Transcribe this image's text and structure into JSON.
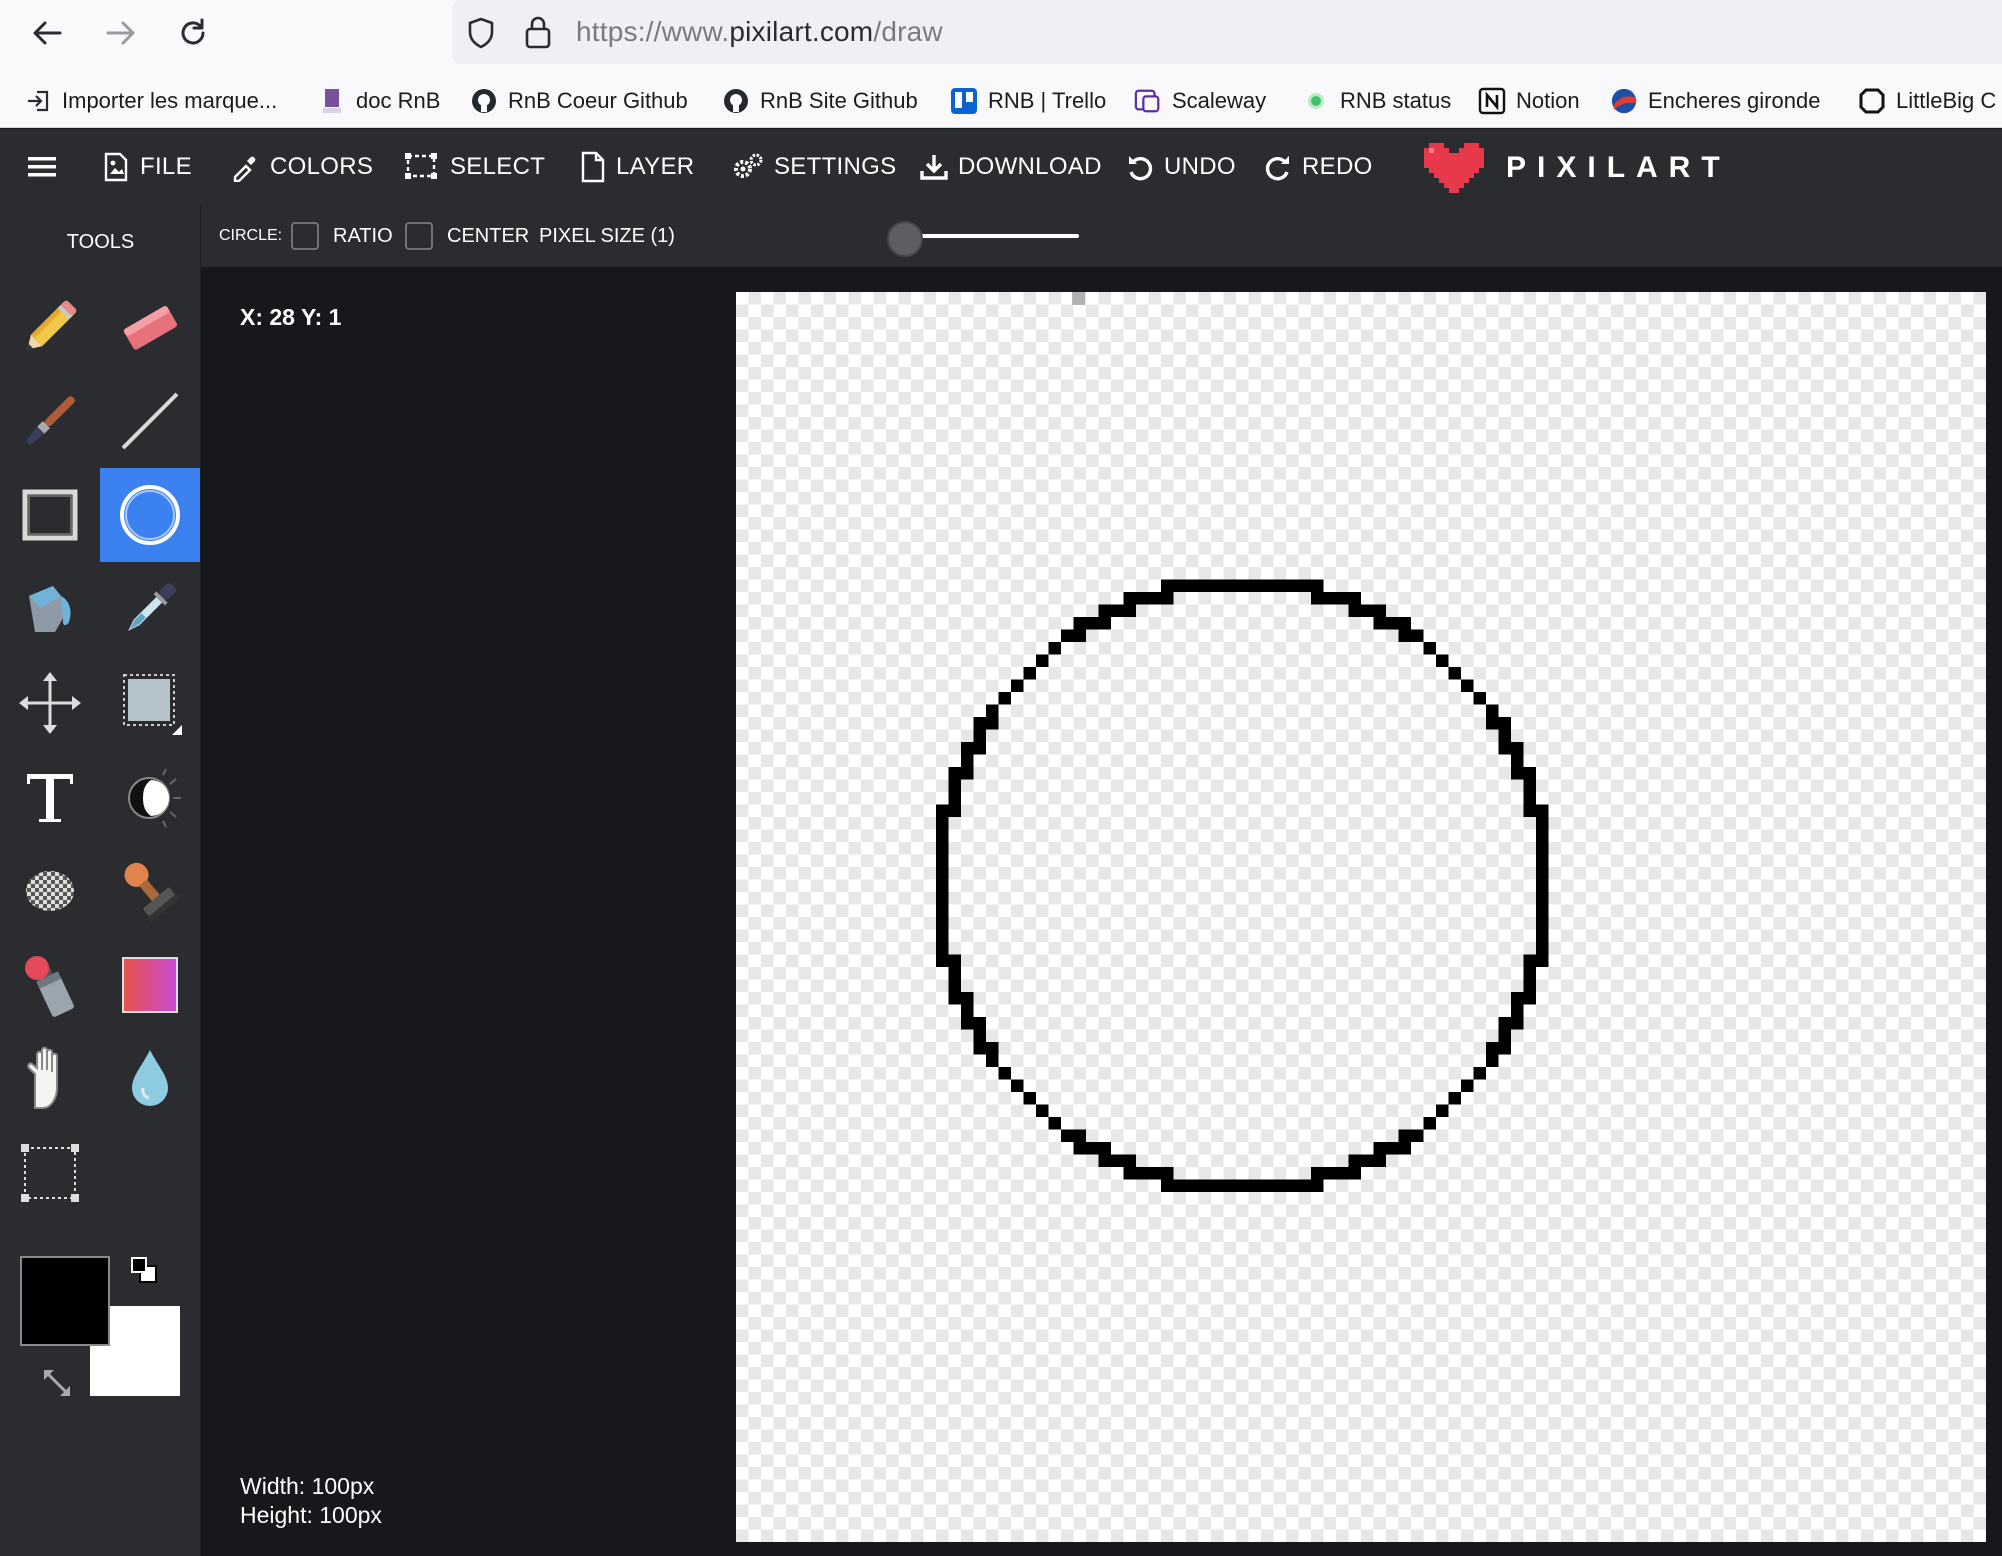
{
  "browser": {
    "url_prefix": "https://www.",
    "url_domain": "pixilart.com",
    "url_path": "/draw",
    "bookmarks": [
      {
        "label": "Importer les marque...",
        "icon": "import-icon"
      },
      {
        "label": "doc RnB",
        "icon": "doc-icon"
      },
      {
        "label": "RnB Coeur Github",
        "icon": "github-icon"
      },
      {
        "label": "RnB Site Github",
        "icon": "github-icon"
      },
      {
        "label": "RNB | Trello",
        "icon": "trello-icon"
      },
      {
        "label": "Scaleway",
        "icon": "scaleway-icon"
      },
      {
        "label": "RNB status",
        "icon": "status-dot-icon"
      },
      {
        "label": "Notion",
        "icon": "notion-icon"
      },
      {
        "label": "Encheres gironde",
        "icon": "encheres-icon"
      },
      {
        "label": "LittleBig C",
        "icon": "littlebig-icon"
      }
    ]
  },
  "app": {
    "menu": {
      "file": "FILE",
      "colors": "COLORS",
      "select": "SELECT",
      "layer": "LAYER",
      "settings": "SETTINGS",
      "download": "DOWNLOAD",
      "undo": "UNDO",
      "redo": "REDO"
    },
    "logo": "PIXILART",
    "accent_color": "#3b82f0",
    "logo_color": "#e8394a"
  },
  "options": {
    "tool_label": "CIRCLE:",
    "ratio_label": "RATIO",
    "ratio_checked": false,
    "center_label": "CENTER",
    "center_checked": false,
    "pixel_size_label": "PIXEL SIZE (1)"
  },
  "tools": {
    "title": "TOOLS",
    "active": "circle-tool",
    "items": [
      "pencil",
      "eraser",
      "brush",
      "line",
      "rectangle",
      "circle",
      "fill-bucket",
      "eyedropper",
      "move",
      "selection",
      "text",
      "lighten-darken",
      "dither",
      "stamp",
      "spray",
      "gradient",
      "hand",
      "blur",
      "crop"
    ]
  },
  "colors": {
    "primary": "#000000",
    "secondary": "#ffffff"
  },
  "workspace": {
    "coords": "X: 28 Y: 1",
    "width_label": "Width: 100px",
    "height_label": "Height: 100px"
  }
}
